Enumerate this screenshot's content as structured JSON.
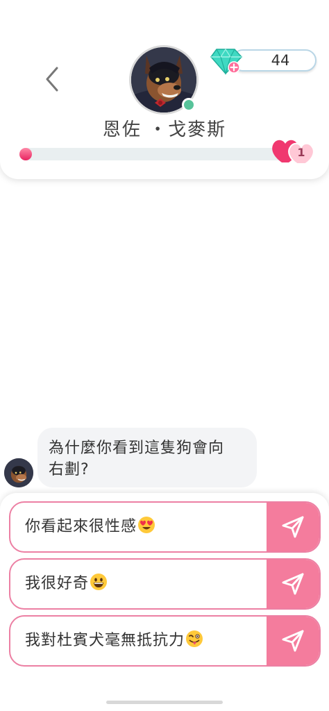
{
  "header": {
    "character_name": "恩佐 ・戈麥斯",
    "gems": "44",
    "affection_level": "1",
    "affection_progress": 0.03,
    "status": "online",
    "icons": {
      "back": "chevron-left-icon",
      "gem": "diamond-icon",
      "add": "plus-icon",
      "level": "hearts-icon"
    },
    "colors": {
      "accent": "#f47c9d",
      "online": "#57c39a",
      "progress": "#e82460"
    }
  },
  "chat": {
    "messages": [
      {
        "sender": "bot",
        "text_line1": "為什麼你看到這隻狗會向",
        "text_line2": "右劃?"
      }
    ]
  },
  "replies": [
    {
      "text": "你看起來很性感",
      "emoji": "heart-eyes-emoji"
    },
    {
      "text": "我很好奇",
      "emoji": "grinning-emoji"
    },
    {
      "text": "我對杜賓犬毫無抵抗力",
      "emoji": "winking-tongue-emoji"
    }
  ]
}
